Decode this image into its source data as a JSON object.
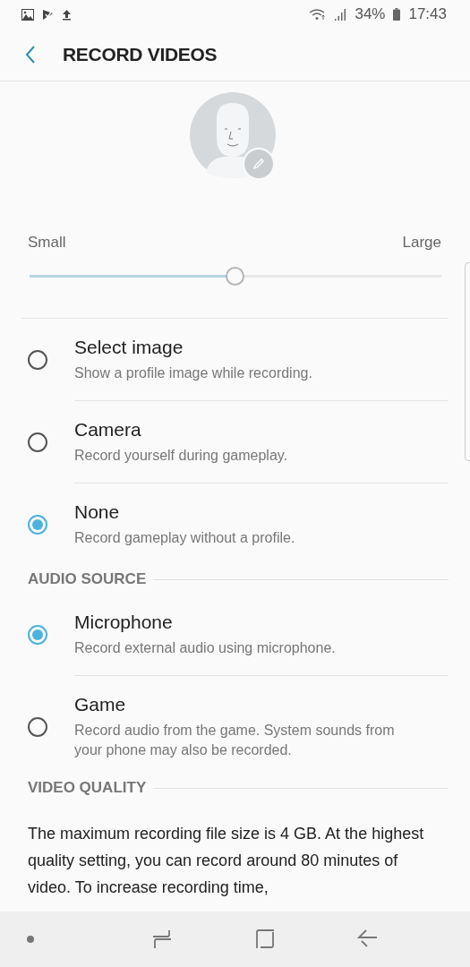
{
  "status_bar": {
    "battery": "34%",
    "time": "17:43"
  },
  "header": {
    "title": "RECORD VIDEOS"
  },
  "size_slider": {
    "min_label": "Small",
    "max_label": "Large",
    "level": 0.5
  },
  "profile_options": [
    {
      "title": "Select image",
      "subtitle": "Show a profile image while recording.",
      "selected": false
    },
    {
      "title": "Camera",
      "subtitle": "Record yourself during gameplay.",
      "selected": false
    },
    {
      "title": "None",
      "subtitle": "Record gameplay without a profile.",
      "selected": true
    }
  ],
  "audio_source": {
    "heading": "AUDIO SOURCE",
    "options": [
      {
        "title": "Microphone",
        "subtitle": "Record external audio using microphone.",
        "selected": true
      },
      {
        "title": "Game",
        "subtitle": "Record audio from the game. System sounds from your phone may also be recorded.",
        "selected": false
      }
    ]
  },
  "video_quality": {
    "heading": "VIDEO QUALITY",
    "text": "The maximum recording file size is 4 GB. At the highest quality setting, you can record around 80 minutes of video. To increase recording time,"
  }
}
